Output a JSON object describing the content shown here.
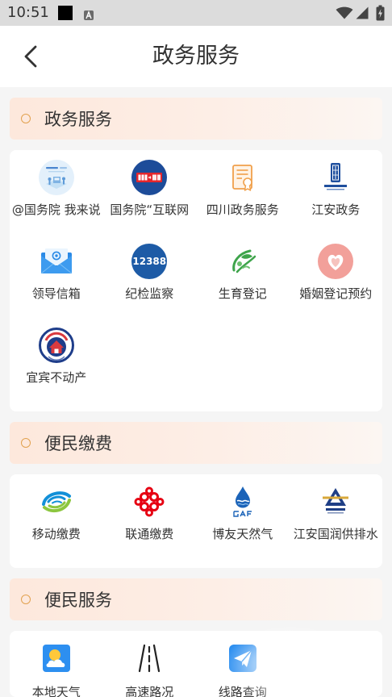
{
  "status_bar": {
    "time": "10:51",
    "icons": [
      "notification-icon",
      "a-badge-icon",
      "wifi-icon",
      "signal-icon",
      "battery-charging-icon"
    ]
  },
  "header": {
    "title": "政务服务",
    "back_icon": "chevron-left-icon"
  },
  "sections": [
    {
      "title": "政务服务",
      "items": [
        {
          "label": "@国务院 我来说",
          "icon": "gov-illustration-icon"
        },
        {
          "label": "国务院“互联网",
          "icon": "internet-supervision-logo-icon"
        },
        {
          "label": "四川政务服务",
          "icon": "certificate-document-icon"
        },
        {
          "label": "江安政务",
          "icon": "jiangan-gov-emblem-icon"
        },
        {
          "label": "领导信箱",
          "icon": "mail-envelope-icon"
        },
        {
          "label": "纪检监察",
          "icon": "hotline-12388-icon",
          "icon_text": "12388"
        },
        {
          "label": "生育登记",
          "icon": "green-leaf-logo-icon"
        },
        {
          "label": "婚姻登记预约",
          "icon": "heart-icon"
        },
        {
          "label": "宜宾不动产",
          "icon": "real-estate-seal-icon"
        }
      ]
    },
    {
      "title": "便民缴费",
      "items": [
        {
          "label": "移动缴费",
          "icon": "china-mobile-logo-icon"
        },
        {
          "label": "联通缴费",
          "icon": "china-unicom-logo-icon"
        },
        {
          "label": "博友天然气",
          "icon": "gas-flame-logo-icon"
        },
        {
          "label": "江安国润供排水",
          "icon": "water-company-logo-icon"
        }
      ]
    },
    {
      "title": "便民服务",
      "items": [
        {
          "label": "本地天气",
          "icon": "weather-icon"
        },
        {
          "label": "高速路况",
          "icon": "highway-road-icon"
        },
        {
          "label": "线路查询",
          "icon": "paper-plane-icon"
        }
      ]
    }
  ],
  "colors": {
    "page_background": "#f5f5f5",
    "status_bar": "#dcdcdc",
    "section_bullet": "#e2a14f",
    "section_header_background": "#fde8dc",
    "text": "#333333",
    "card_background": "#ffffff"
  }
}
